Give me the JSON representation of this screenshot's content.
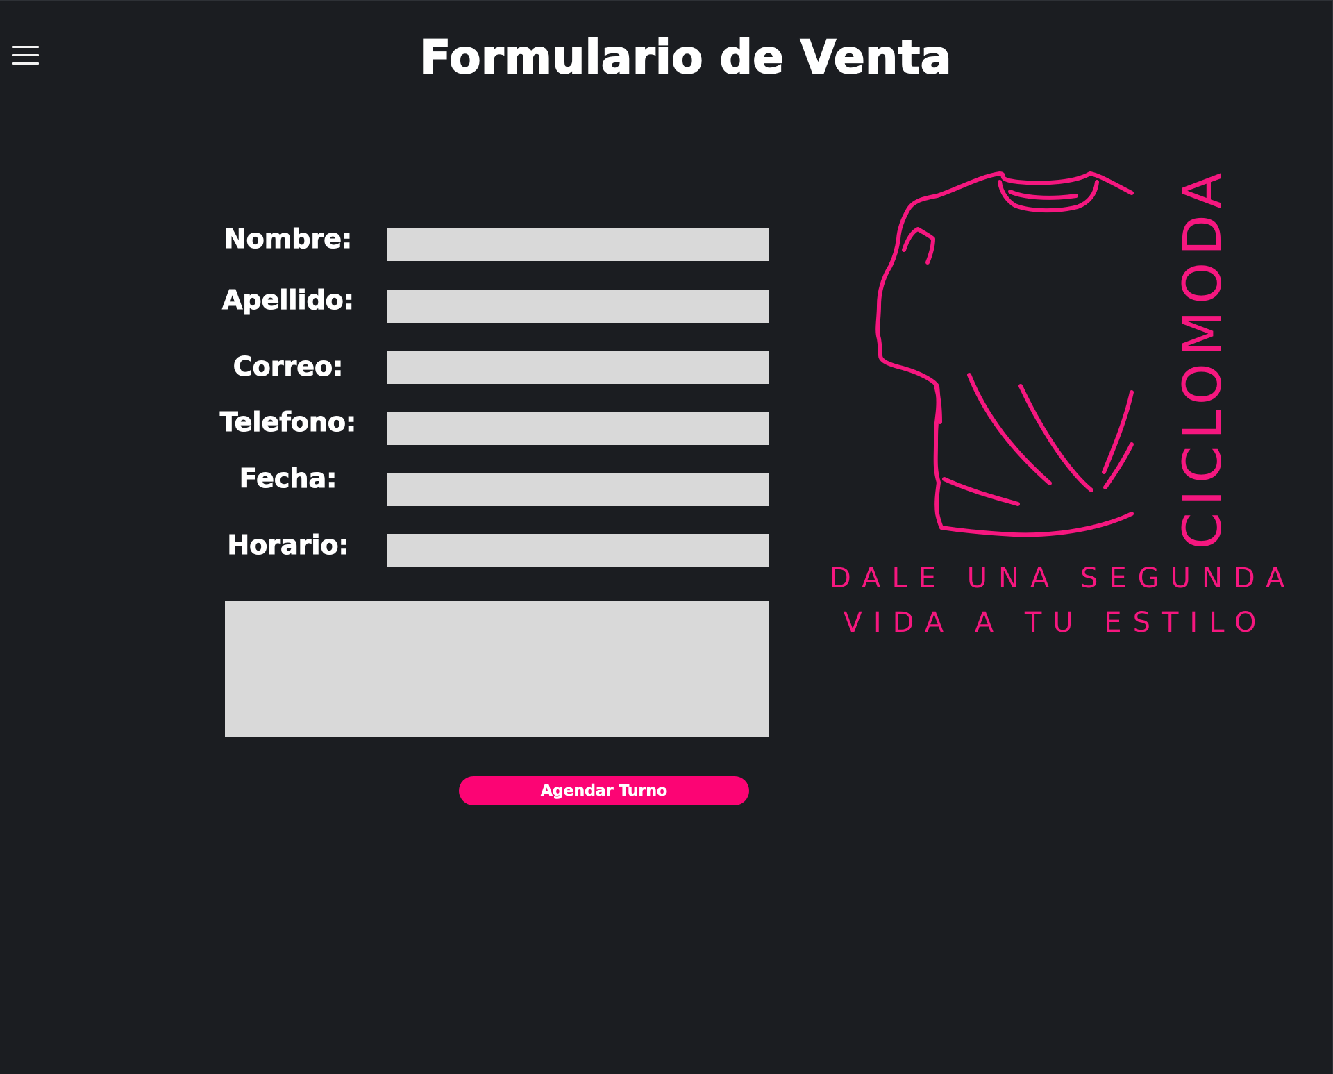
{
  "header": {
    "title": "Formulario de Venta",
    "menu_icon": "hamburger-menu-icon"
  },
  "form": {
    "fields": [
      {
        "label": "Nombre:",
        "value": "",
        "placeholder": ""
      },
      {
        "label": "Apellido:",
        "value": "",
        "placeholder": ""
      },
      {
        "label": "Correo:",
        "value": "",
        "placeholder": ""
      },
      {
        "label": "Telefono:",
        "value": "",
        "placeholder": ""
      },
      {
        "label": "Fecha:",
        "value": "",
        "placeholder": ""
      },
      {
        "label": "Horario:",
        "value": "",
        "placeholder": ""
      }
    ],
    "message": {
      "value": "",
      "placeholder": ""
    },
    "submit_label": "Agendar Turno"
  },
  "brand": {
    "name": "CICLOMODA",
    "tagline_line1": "DALE UNA SEGUNDA",
    "tagline_line2": "VIDA A TU ESTILO",
    "logo_icon": "t-shirt-icon"
  },
  "colors": {
    "background": "#1b1d21",
    "accent": "#fc0474",
    "input_background": "#d9d9d9",
    "text": "#ffffff"
  }
}
